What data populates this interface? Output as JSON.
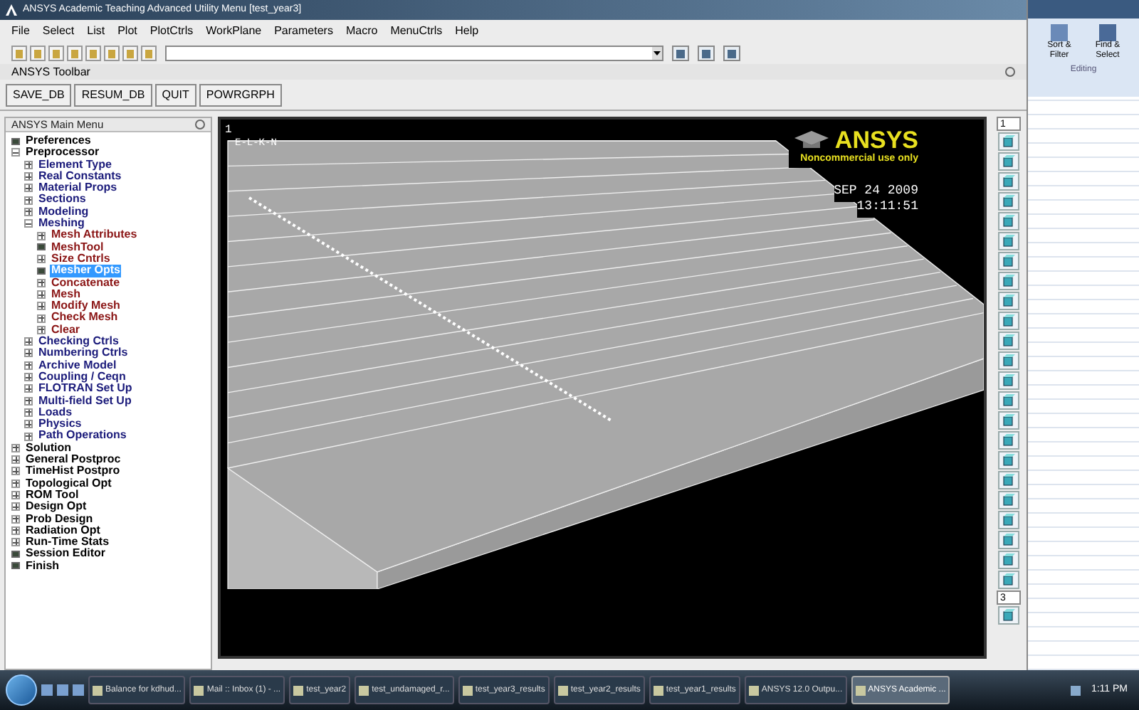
{
  "window": {
    "title": "ANSYS Academic Teaching Advanced Utility Menu [test_year3]"
  },
  "menu": [
    "File",
    "Select",
    "List",
    "Plot",
    "PlotCtrls",
    "WorkPlane",
    "Parameters",
    "Macro",
    "MenuCtrls",
    "Help"
  ],
  "toolbar": {
    "title": "ANSYS Toolbar",
    "buttons": [
      "SAVE_DB",
      "RESUM_DB",
      "QUIT",
      "POWRGRPH"
    ]
  },
  "main_menu": {
    "title": "ANSYS Main Menu",
    "items": [
      {
        "label": "Preferences",
        "kind": "leaf",
        "selected": false
      },
      {
        "label": "Preprocessor",
        "kind": "branch",
        "expanded": true,
        "children": [
          {
            "label": "Element Type",
            "kind": "branch",
            "expanded": false
          },
          {
            "label": "Real Constants",
            "kind": "branch",
            "expanded": false
          },
          {
            "label": "Material Props",
            "kind": "branch",
            "expanded": false
          },
          {
            "label": "Sections",
            "kind": "branch",
            "expanded": false
          },
          {
            "label": "Modeling",
            "kind": "branch",
            "expanded": false
          },
          {
            "label": "Meshing",
            "kind": "branch",
            "expanded": true,
            "children": [
              {
                "label": "Mesh Attributes",
                "kind": "branch",
                "expanded": false
              },
              {
                "label": "MeshTool",
                "kind": "leaf",
                "selected": false
              },
              {
                "label": "Size Cntrls",
                "kind": "branch",
                "expanded": false
              },
              {
                "label": "Mesher Opts",
                "kind": "leaf",
                "selected": true
              },
              {
                "label": "Concatenate",
                "kind": "branch",
                "expanded": false
              },
              {
                "label": "Mesh",
                "kind": "branch",
                "expanded": false
              },
              {
                "label": "Modify Mesh",
                "kind": "branch",
                "expanded": false
              },
              {
                "label": "Check Mesh",
                "kind": "branch",
                "expanded": false
              },
              {
                "label": "Clear",
                "kind": "branch",
                "expanded": false
              }
            ]
          },
          {
            "label": "Checking Ctrls",
            "kind": "branch",
            "expanded": false
          },
          {
            "label": "Numbering Ctrls",
            "kind": "branch",
            "expanded": false
          },
          {
            "label": "Archive Model",
            "kind": "branch",
            "expanded": false
          },
          {
            "label": "Coupling / Ceqn",
            "kind": "branch",
            "expanded": false
          },
          {
            "label": "FLOTRAN Set Up",
            "kind": "branch",
            "expanded": false
          },
          {
            "label": "Multi-field Set Up",
            "kind": "branch",
            "expanded": false
          },
          {
            "label": "Loads",
            "kind": "branch",
            "expanded": false
          },
          {
            "label": "Physics",
            "kind": "branch",
            "expanded": false
          },
          {
            "label": "Path Operations",
            "kind": "branch",
            "expanded": false
          }
        ]
      },
      {
        "label": "Solution",
        "kind": "branch",
        "expanded": false
      },
      {
        "label": "General Postproc",
        "kind": "branch",
        "expanded": false
      },
      {
        "label": "TimeHist Postpro",
        "kind": "branch",
        "expanded": false
      },
      {
        "label": "Topological Opt",
        "kind": "branch",
        "expanded": false
      },
      {
        "label": "ROM Tool",
        "kind": "branch",
        "expanded": false
      },
      {
        "label": "Design Opt",
        "kind": "branch",
        "expanded": false
      },
      {
        "label": "Prob Design",
        "kind": "branch",
        "expanded": false
      },
      {
        "label": "Radiation Opt",
        "kind": "branch",
        "expanded": false
      },
      {
        "label": "Run-Time Stats",
        "kind": "branch",
        "expanded": false
      },
      {
        "label": "Session Editor",
        "kind": "leaf",
        "selected": false
      },
      {
        "label": "Finish",
        "kind": "leaf",
        "selected": false
      }
    ]
  },
  "graphics": {
    "window_number": "1",
    "plot_label": "E-L-K-N",
    "logo": "ANSYS",
    "logo_note": "Noncommercial use only",
    "date": "SEP 24 2009",
    "time": "13:11:51"
  },
  "view_toolbar": {
    "window_select": "1",
    "bottom_select": "3"
  },
  "excel": {
    "sort_filter": "Sort & Filter",
    "find_select": "Find & Select",
    "group": "Editing"
  },
  "taskbar": {
    "items": [
      {
        "label": "Balance for kdhud...",
        "selected": false
      },
      {
        "label": "Mail :: Inbox (1) - ...",
        "selected": false
      },
      {
        "label": "test_year2",
        "selected": false
      },
      {
        "label": "test_undamaged_r...",
        "selected": false
      },
      {
        "label": "test_year3_results",
        "selected": false
      },
      {
        "label": "test_year2_results",
        "selected": false
      },
      {
        "label": "test_year1_results",
        "selected": false
      },
      {
        "label": "ANSYS 12.0 Outpu...",
        "selected": false
      },
      {
        "label": "ANSYS Academic ...",
        "selected": true
      }
    ],
    "clock": "1:11 PM"
  }
}
